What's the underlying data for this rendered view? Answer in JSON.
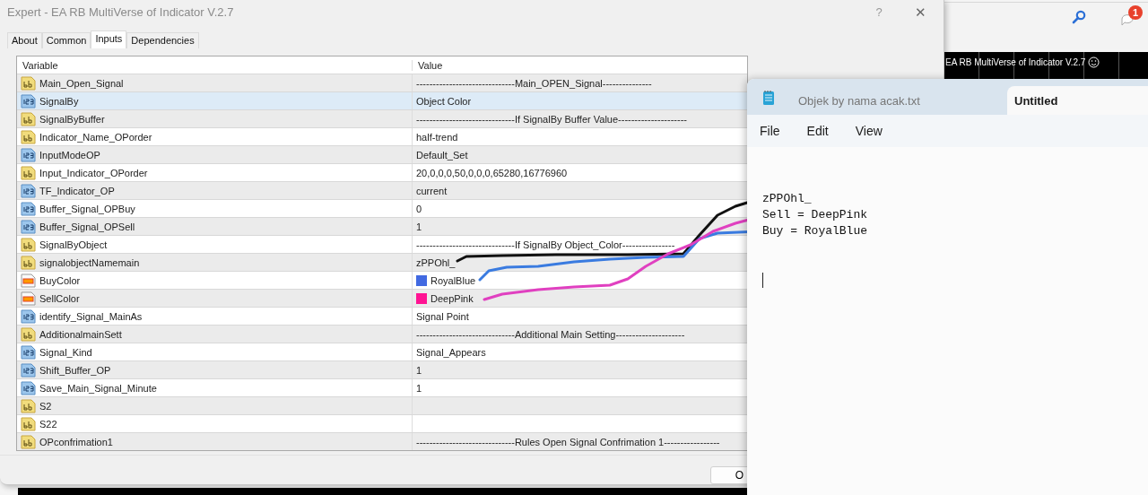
{
  "background_app": {
    "notification_badge": "1",
    "chart_label": "EA RB MultiVerse of Indicator V.2.7"
  },
  "dialog": {
    "title": "Expert - EA RB MultiVerse of Indicator V.2.7",
    "help": "?",
    "close": "✕",
    "tabs": [
      {
        "label": "About",
        "selected": false
      },
      {
        "label": "Common",
        "selected": false
      },
      {
        "label": "Inputs",
        "selected": true
      },
      {
        "label": "Dependencies",
        "selected": false
      }
    ],
    "table": {
      "columns": [
        "Variable",
        "Value"
      ],
      "rows": [
        {
          "name": "Main_Open_Signal",
          "kind": "string",
          "value": "------------------------------Main_OPEN_Signal---------------",
          "selected": false
        },
        {
          "name": "SignalBy",
          "kind": "number",
          "value": "Object Color",
          "selected": true
        },
        {
          "name": "SignalByBuffer",
          "kind": "string",
          "value": "------------------------------If SignalBy Buffer Value---------------------",
          "selected": false
        },
        {
          "name": "Indicator_Name_OPorder",
          "kind": "string",
          "value": "half-trend",
          "selected": false
        },
        {
          "name": "InputModeOP",
          "kind": "number",
          "value": "Default_Set",
          "selected": false
        },
        {
          "name": "Input_Indicator_OPorder",
          "kind": "string",
          "value": "20,0,0,0,50,0,0,0,65280,16776960",
          "selected": false
        },
        {
          "name": "TF_Indicator_OP",
          "kind": "number",
          "value": "current",
          "selected": false
        },
        {
          "name": "Buffer_Signal_OPBuy",
          "kind": "number",
          "value": "0",
          "selected": false
        },
        {
          "name": "Buffer_Signal_OPSell",
          "kind": "number",
          "value": "1",
          "selected": false
        },
        {
          "name": "SignalByObject",
          "kind": "string",
          "value": "------------------------------If SignalBy Object_Color----------------",
          "selected": false
        },
        {
          "name": "signalobjectNamemain",
          "kind": "string",
          "value": "zPPOhl_",
          "selected": false
        },
        {
          "name": "BuyColor",
          "kind": "color",
          "value": "RoyalBlue",
          "color": "#4169e1",
          "selected": false
        },
        {
          "name": "SellColor",
          "kind": "color",
          "value": "DeepPink",
          "color": "#ff1493",
          "selected": false
        },
        {
          "name": "identify_Signal_MainAs",
          "kind": "number",
          "value": "Signal Point",
          "selected": false
        },
        {
          "name": "AdditionalmainSett",
          "kind": "string",
          "value": "------------------------------Additional Main Setting---------------------",
          "selected": false
        },
        {
          "name": "Signal_Kind",
          "kind": "number",
          "value": "Signal_Appears",
          "selected": false
        },
        {
          "name": "Shift_Buffer_OP",
          "kind": "number",
          "value": "1",
          "selected": false
        },
        {
          "name": "Save_Main_Signal_Minute",
          "kind": "number",
          "value": "1",
          "selected": false
        },
        {
          "name": "S2",
          "kind": "string",
          "selected": false
        },
        {
          "name": "S22",
          "kind": "string",
          "selected": false
        },
        {
          "name": "OPconfrimation1",
          "kind": "string",
          "value": "------------------------------Rules Open Signal Confrimation 1-----------------",
          "selected": false
        }
      ]
    },
    "buttons": [
      "O"
    ]
  },
  "notepad": {
    "tabs": [
      {
        "label": "Objek by nama acak.txt",
        "selected": false
      },
      {
        "label": "Untitled",
        "selected": true
      }
    ],
    "menu": [
      "File",
      "Edit",
      "View"
    ],
    "lines": [
      "zPPOhl_",
      "Sell = DeepPink",
      "Buy = RoyalBlue"
    ]
  }
}
